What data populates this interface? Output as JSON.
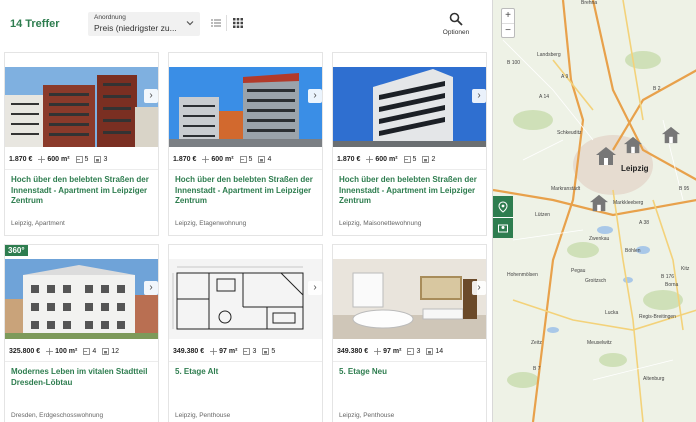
{
  "header": {
    "results": "14 Treffer",
    "sort_label": "Anordnung",
    "sort_value": "Preis (niedrigster zu...",
    "options_label": "Optionen"
  },
  "colors": {
    "accent": "#2e7d4f",
    "map_bg": "#eef2e6"
  },
  "icons": {
    "search": "search-icon",
    "list": "list-view-icon",
    "grid": "grid-view-icon",
    "area": "area-icon",
    "rooms": "rooms-icon",
    "bath": "bath-icon"
  },
  "listings": [
    {
      "price": "1.870 €",
      "area": "600 m²",
      "rooms": "5",
      "baths": "3",
      "title": "Hoch über den belebten Straßen der Innenstadt - Apartment im Leipziger Zentrum",
      "subtitle": "Leipzig, Apartment",
      "badge": ""
    },
    {
      "price": "1.870 €",
      "area": "600 m²",
      "rooms": "5",
      "baths": "4",
      "title": "Hoch über den belebten Straßen der Innenstadt - Apartment im Leipziger Zentrum",
      "subtitle": "Leipzig, Etagenwohnung",
      "badge": ""
    },
    {
      "price": "1.870 €",
      "area": "600 m²",
      "rooms": "5",
      "baths": "2",
      "title": "Hoch über den belebten Straßen der Innenstadt - Apartment im Leipziger Zentrum",
      "subtitle": "Leipzig, Maisonettewohnung",
      "badge": ""
    },
    {
      "price": "325.800 €",
      "area": "100 m²",
      "rooms": "4",
      "baths": "12",
      "title": "Modernes Leben im vitalen Stadtteil Dresden-Löbtau",
      "subtitle": "Dresden, Erdgeschosswohnung",
      "badge": "360°"
    },
    {
      "price": "349.380 €",
      "area": "97 m²",
      "rooms": "3",
      "baths": "5",
      "title": "5. Etage Alt",
      "subtitle": "Leipzig, Penthouse",
      "badge": ""
    },
    {
      "price": "349.380 €",
      "area": "97 m²",
      "rooms": "3",
      "baths": "14",
      "title": "5. Etage Neu",
      "subtitle": "Leipzig, Penthouse",
      "badge": ""
    }
  ],
  "map": {
    "zoom_in": "+",
    "zoom_out": "−",
    "labels": [
      "Brehna",
      "Landsberg",
      "B 100",
      "A 9",
      "A 14",
      "Schkeuditz",
      "Leipzig",
      "Markranstädt",
      "Markkleeberg",
      "Lützen",
      "Zwenkau",
      "Böhlen",
      "Hohenmölsen",
      "Pegau",
      "Groitzsch",
      "Zeitz",
      "Meuselwitz",
      "Altenburg",
      "Borna",
      "B 2",
      "A 38",
      "B 176",
      "Lucka",
      "Regis-Breitingen",
      "B 7",
      "B 95",
      "Kitz"
    ],
    "city": "Leipzig"
  }
}
